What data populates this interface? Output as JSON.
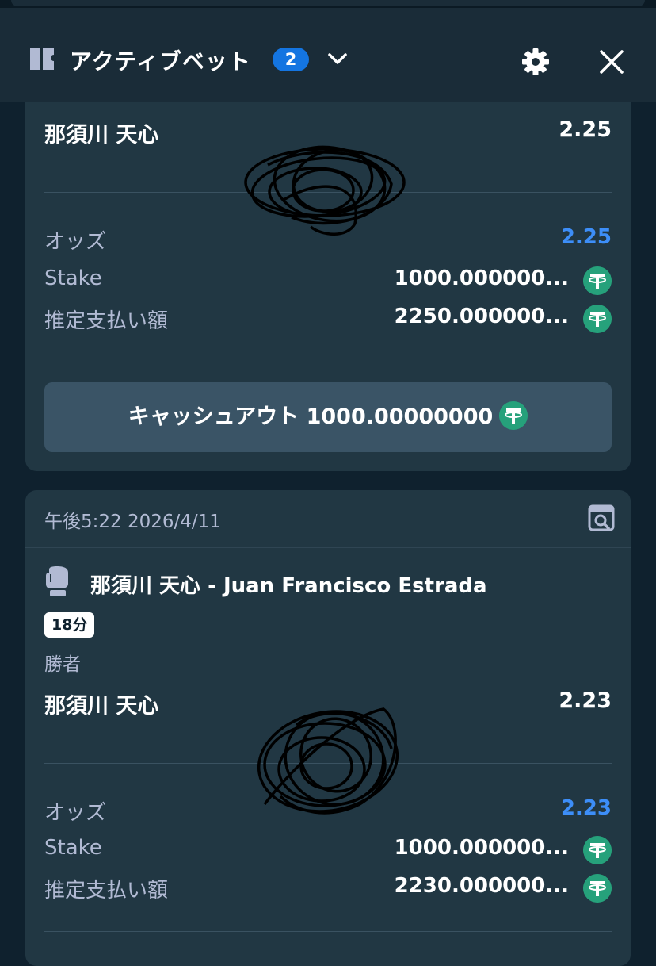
{
  "header": {
    "title": "アクティブベット",
    "count": "2"
  },
  "bet1": {
    "selection": "那須川 天心",
    "selection_odds": "2.25",
    "odds_label": "オッズ",
    "odds_value": "2.25",
    "stake_label": "Stake",
    "stake_value": "1000.000000...",
    "payout_label": "推定支払い額",
    "payout_value": "2250.000000...",
    "cashout_label": "キャッシュアウト 1000.00000000"
  },
  "bet2": {
    "timestamp": "午後5:22 2026/4/11",
    "event_title": "那須川 天心 - Juan Francisco Estrada",
    "time_badge": "18分",
    "market": "勝者",
    "selection": "那須川 天心",
    "selection_odds": "2.23",
    "odds_label": "オッズ",
    "odds_value": "2.23",
    "stake_label": "Stake",
    "stake_value": "1000.000000...",
    "payout_label": "推定支払い額",
    "payout_value": "2230.000000..."
  },
  "colors": {
    "background": "#0f212e",
    "card": "#213743",
    "accent_blue": "#1475e1",
    "odds_blue": "#3d8ef8",
    "usdt_green": "#26a17b",
    "muted_text": "#b1bad3"
  },
  "icons": [
    "bet-slip-icon",
    "chevron-down-icon",
    "gear-icon",
    "close-icon",
    "usdt-icon",
    "ticket-search-icon",
    "boxing-glove-icon"
  ]
}
